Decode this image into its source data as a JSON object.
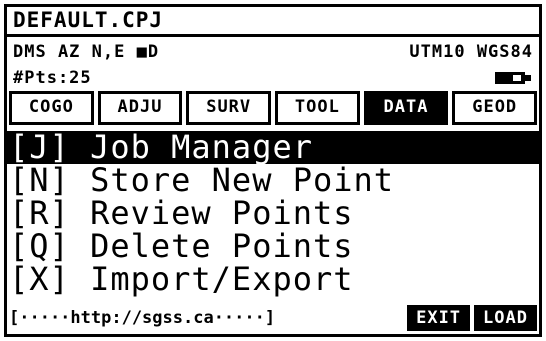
{
  "window": {
    "title": "DEFAULT.CPJ"
  },
  "status": {
    "units_text": "DMS AZ N,E ■D",
    "projection_text": "UTM10 WGS84",
    "points_text": "#Pts:25"
  },
  "tabs": [
    {
      "label": "COGO",
      "active": false
    },
    {
      "label": "ADJU",
      "active": false
    },
    {
      "label": "SURV",
      "active": false
    },
    {
      "label": "TOOL",
      "active": false
    },
    {
      "label": "DATA",
      "active": true
    },
    {
      "label": "GEOD",
      "active": false
    }
  ],
  "menu": {
    "items": [
      {
        "label": "[J] Job Manager",
        "selected": true
      },
      {
        "label": "[N] Store New Point",
        "selected": false
      },
      {
        "label": "[R] Review Points",
        "selected": false
      },
      {
        "label": "[Q] Delete Points",
        "selected": false
      },
      {
        "label": "[X] Import/Export",
        "selected": false
      }
    ]
  },
  "footer": {
    "url_text": "[·····http://sgss.ca·····]",
    "exit_label": "EXIT",
    "load_label": "LOAD"
  },
  "icons": {
    "battery": "battery-icon"
  },
  "colors": {
    "foreground": "#000000",
    "background": "#ffffff"
  }
}
